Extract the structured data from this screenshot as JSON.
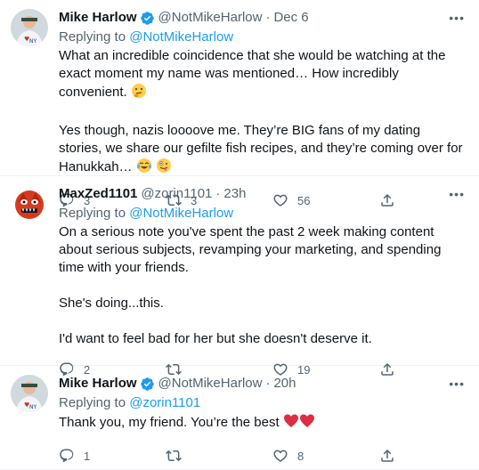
{
  "tweets": [
    {
      "author_name": "Mike Harlow",
      "handle": "@NotMikeHarlow",
      "dot": "·",
      "time": "Dec 6",
      "replying_prefix": "Replying to ",
      "replying_to": "@NotMikeHarlow",
      "text_1": "What an incredible coincidence that she would be watching at the exact moment my name was mentioned… How incredibly convenient. ",
      "text_2": "Yes though, nazis loooove me. They’re BIG fans of my dating stories, we share our gefilte fish recipes, and they’re coming over for Hanukkah… ",
      "reply_count": "3",
      "retweet_count": "3",
      "like_count": "56",
      "more_label": "•••"
    },
    {
      "author_name": "MaxZed1101",
      "handle": "@zorin1101",
      "dot": "·",
      "time": "23h",
      "replying_prefix": "Replying to ",
      "replying_to": "@NotMikeHarlow",
      "text_1": "On a serious note you've spent the past 2 week making content about serious subjects, revamping your marketing, and spending time with your friends.",
      "text_2": "She's doing...this.",
      "text_3": "I'd want to feel bad for her but she doesn't deserve it.",
      "reply_count": "2",
      "retweet_count": "",
      "like_count": "19",
      "more_label": "•••"
    },
    {
      "author_name": "Mike Harlow",
      "handle": "@NotMikeHarlow",
      "dot": "·",
      "time": "20h",
      "replying_prefix": "Replying to ",
      "replying_to": "@zorin1101",
      "text_1": "Thank you, my friend. You’re the best ",
      "reply_count": "1",
      "retweet_count": "",
      "like_count": "8",
      "more_label": "•••"
    }
  ],
  "colors": {
    "link": "#1d9bf0",
    "secondary_text": "#536471",
    "primary_text": "#0f1419",
    "divider": "#eff3f4"
  },
  "icons": [
    "verified-badge-icon",
    "reply-icon",
    "retweet-icon",
    "like-icon",
    "share-icon",
    "more-icon"
  ]
}
